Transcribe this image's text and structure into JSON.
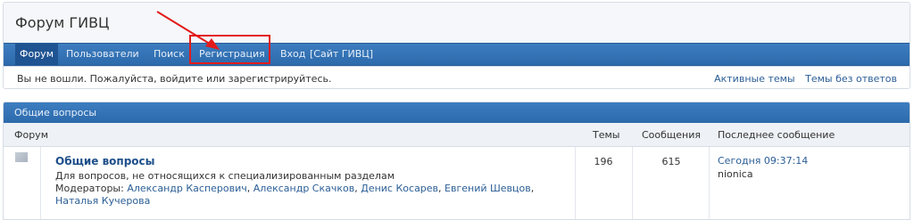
{
  "header": {
    "title": "Форум ГИВЦ"
  },
  "menu": {
    "forum": "Форум",
    "users": "Пользователи",
    "search": "Поиск",
    "register": "Регистрация",
    "login": "Вход",
    "site": "[Сайт ГИВЦ]"
  },
  "status": {
    "message": "Вы не вошли. Пожалуйста, войдите или зарегистрируйтесь.",
    "active_topics": "Активные темы",
    "unanswered_topics": "Темы без ответов"
  },
  "category": {
    "title": "Общие вопросы"
  },
  "columns": {
    "forum": "Форум",
    "topics": "Темы",
    "posts": "Сообщения",
    "last_post": "Последнее сообщение"
  },
  "forum_row": {
    "name": "Общие вопросы",
    "description": "Для вопросов, не относящихся к специализированным разделам",
    "moderators_label": "Модераторы: ",
    "moderators": [
      "Александр Касперович",
      "Александр Скачков",
      "Денис Косарев",
      "Евгений Шевцов",
      "Наталья Кучерова"
    ],
    "topics": "196",
    "posts": "615",
    "last_post_time": "Сегодня 09:37:14",
    "last_post_user": "nionica"
  },
  "annotation": {
    "color": "#e31b1b"
  },
  "icons": {
    "forum_status": "forum-read-icon"
  }
}
